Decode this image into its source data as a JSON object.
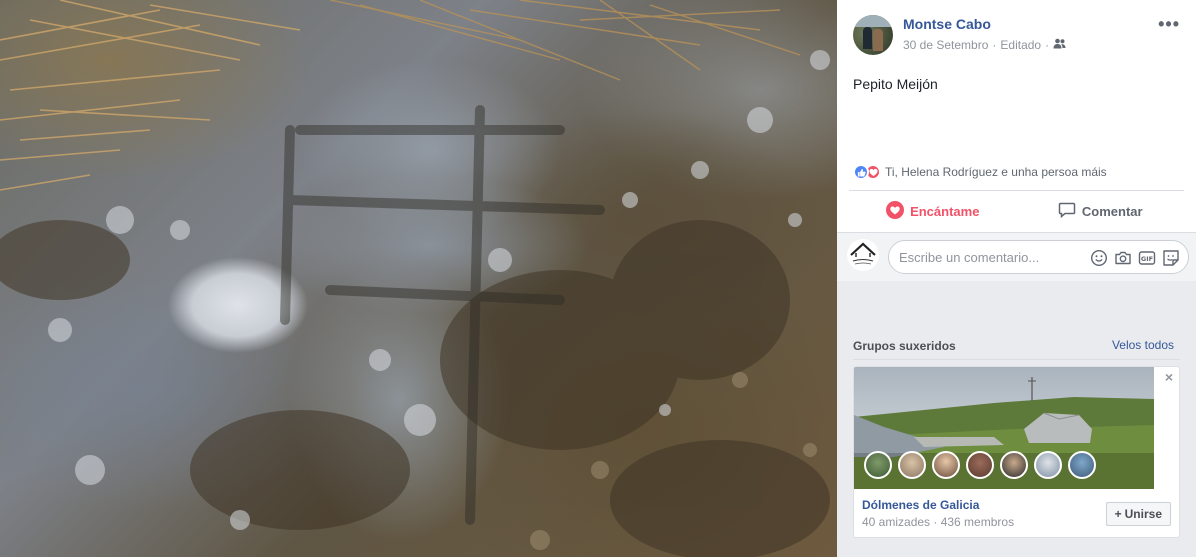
{
  "post": {
    "author": "Montse Cabo",
    "date": "30 de Setembro",
    "edited": "Editado",
    "audience_icon": "friends-icon",
    "more_icon": "more-options-icon",
    "text": "Pepito Meijón",
    "reactions": {
      "types": [
        "like",
        "love"
      ],
      "summary": "Ti, Helena Rodríguez e unha persoa máis"
    },
    "actions": {
      "love_label": "Encántame",
      "comment_label": "Comentar"
    },
    "comment_placeholder": "Escribe un comentario...",
    "comment_icons": [
      "emoji-icon",
      "camera-icon",
      "gif-icon",
      "sticker-icon"
    ]
  },
  "suggested_groups": {
    "title": "Grupos suxeridos",
    "see_all": "Velos todos",
    "group": {
      "name": "Dólmenes de Galicia",
      "stats": "40 amizades · 436 membros",
      "join_label": "Unirse",
      "dismiss": "×"
    }
  },
  "colors": {
    "link": "#365899",
    "love": "#f25268",
    "like": "#4f86f7",
    "panel_bg": "#e9ebee"
  }
}
